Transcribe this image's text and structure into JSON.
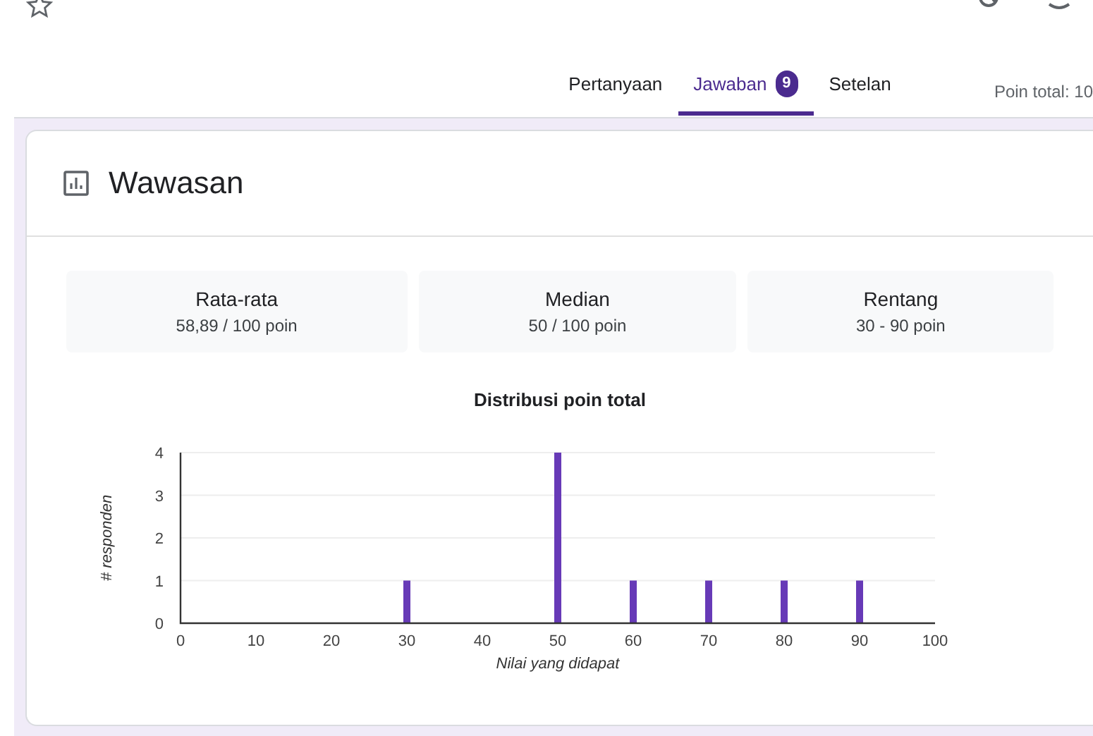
{
  "tabs": [
    {
      "label": "Pertanyaan",
      "selected": false
    },
    {
      "label": "Jawaban",
      "badge": "9",
      "selected": true
    },
    {
      "label": "Setelan",
      "selected": false
    }
  ],
  "total_points": "Poin total: 10",
  "insights": {
    "title": "Wawasan",
    "stats": [
      {
        "label": "Rata-rata",
        "value": "58,89 / 100 poin"
      },
      {
        "label": "Median",
        "value": "50 / 100 poin"
      },
      {
        "label": "Rentang",
        "value": "30 - 90 poin"
      }
    ],
    "chart_data": {
      "type": "bar",
      "title": "Distribusi poin total",
      "xlabel": "Nilai yang didapat",
      "ylabel": "# responden",
      "x": [
        30,
        50,
        60,
        70,
        80,
        90
      ],
      "values": [
        1,
        4,
        1,
        1,
        1,
        1
      ],
      "grid": true,
      "xlim": [
        0,
        100
      ],
      "ylim": [
        0,
        4
      ],
      "xticks": [
        0,
        10,
        20,
        30,
        40,
        50,
        60,
        70,
        80,
        90,
        100
      ],
      "yticks": [
        0,
        1,
        2,
        3,
        4
      ]
    }
  }
}
